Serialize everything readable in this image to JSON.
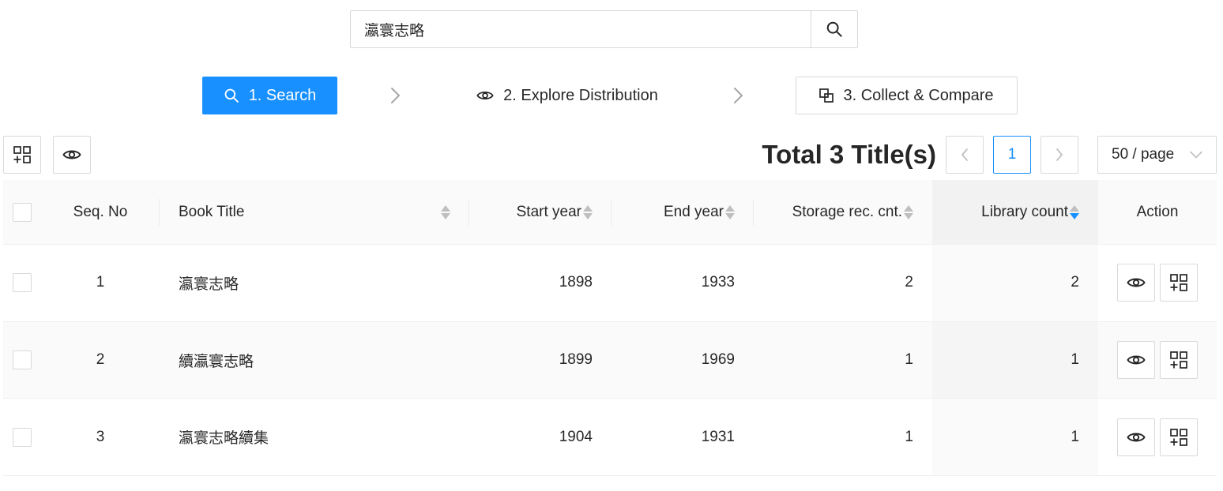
{
  "search": {
    "value": "瀛寰志略",
    "button_icon": "search-icon"
  },
  "steps": [
    {
      "label": "1. Search",
      "icon": "search-icon",
      "active": true
    },
    {
      "label": "2. Explore Distribution",
      "icon": "eye-icon",
      "active": false
    },
    {
      "label": "3. Collect & Compare",
      "icon": "compare-icon",
      "active": false
    }
  ],
  "toolbar": {
    "collect_icon": "collect-add-icon",
    "view_icon": "eye-icon"
  },
  "total_label": "Total 3 Title(s)",
  "pagination": {
    "current_page": "1",
    "page_size": "50 / page"
  },
  "table": {
    "columns": {
      "seq": "Seq. No",
      "title": "Book Title",
      "start": "Start year",
      "end": "End year",
      "storage": "Storage rec. cnt.",
      "library": "Library count",
      "action": "Action"
    },
    "sorted_column": "Library count",
    "sort_order": "descending",
    "rows": [
      {
        "seq": "1",
        "title": "瀛寰志略",
        "start": "1898",
        "end": "1933",
        "storage": "2",
        "library": "2"
      },
      {
        "seq": "2",
        "title": "續瀛寰志略",
        "start": "1899",
        "end": "1969",
        "storage": "1",
        "library": "1"
      },
      {
        "seq": "3",
        "title": "瀛寰志略續集",
        "start": "1904",
        "end": "1931",
        "storage": "1",
        "library": "1"
      }
    ]
  },
  "colors": {
    "primary": "#1890ff",
    "border": "#d9d9d9",
    "header_bg": "#fafafa"
  }
}
